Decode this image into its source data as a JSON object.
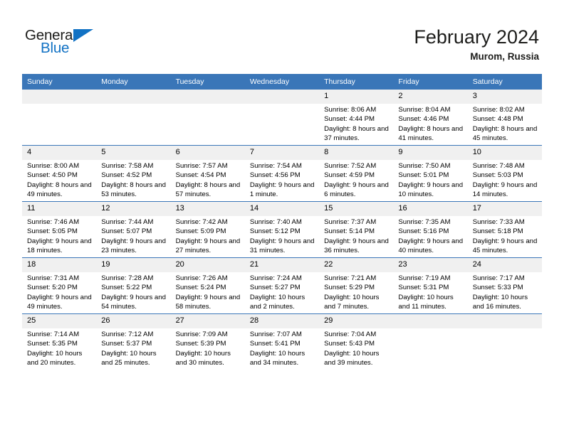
{
  "brand": {
    "name_top": "General",
    "name_bottom": "Blue",
    "accent_color": "#1272c4",
    "triangle_icon": "triangle-icon"
  },
  "header": {
    "title": "February 2024",
    "subtitle": "Murom, Russia"
  },
  "calendar": {
    "header_bg": "#3a76b8",
    "daynum_bg": "#f0f0f0",
    "weekday_names": [
      "Sunday",
      "Monday",
      "Tuesday",
      "Wednesday",
      "Thursday",
      "Friday",
      "Saturday"
    ],
    "weeks": [
      [
        {
          "day": "",
          "empty": true
        },
        {
          "day": "",
          "empty": true
        },
        {
          "day": "",
          "empty": true
        },
        {
          "day": "",
          "empty": true
        },
        {
          "day": "1",
          "sunrise": "Sunrise: 8:06 AM",
          "sunset": "Sunset: 4:44 PM",
          "daylight": "Daylight: 8 hours and 37 minutes."
        },
        {
          "day": "2",
          "sunrise": "Sunrise: 8:04 AM",
          "sunset": "Sunset: 4:46 PM",
          "daylight": "Daylight: 8 hours and 41 minutes."
        },
        {
          "day": "3",
          "sunrise": "Sunrise: 8:02 AM",
          "sunset": "Sunset: 4:48 PM",
          "daylight": "Daylight: 8 hours and 45 minutes."
        }
      ],
      [
        {
          "day": "4",
          "sunrise": "Sunrise: 8:00 AM",
          "sunset": "Sunset: 4:50 PM",
          "daylight": "Daylight: 8 hours and 49 minutes."
        },
        {
          "day": "5",
          "sunrise": "Sunrise: 7:58 AM",
          "sunset": "Sunset: 4:52 PM",
          "daylight": "Daylight: 8 hours and 53 minutes."
        },
        {
          "day": "6",
          "sunrise": "Sunrise: 7:57 AM",
          "sunset": "Sunset: 4:54 PM",
          "daylight": "Daylight: 8 hours and 57 minutes."
        },
        {
          "day": "7",
          "sunrise": "Sunrise: 7:54 AM",
          "sunset": "Sunset: 4:56 PM",
          "daylight": "Daylight: 9 hours and 1 minute."
        },
        {
          "day": "8",
          "sunrise": "Sunrise: 7:52 AM",
          "sunset": "Sunset: 4:59 PM",
          "daylight": "Daylight: 9 hours and 6 minutes."
        },
        {
          "day": "9",
          "sunrise": "Sunrise: 7:50 AM",
          "sunset": "Sunset: 5:01 PM",
          "daylight": "Daylight: 9 hours and 10 minutes."
        },
        {
          "day": "10",
          "sunrise": "Sunrise: 7:48 AM",
          "sunset": "Sunset: 5:03 PM",
          "daylight": "Daylight: 9 hours and 14 minutes."
        }
      ],
      [
        {
          "day": "11",
          "sunrise": "Sunrise: 7:46 AM",
          "sunset": "Sunset: 5:05 PM",
          "daylight": "Daylight: 9 hours and 18 minutes."
        },
        {
          "day": "12",
          "sunrise": "Sunrise: 7:44 AM",
          "sunset": "Sunset: 5:07 PM",
          "daylight": "Daylight: 9 hours and 23 minutes."
        },
        {
          "day": "13",
          "sunrise": "Sunrise: 7:42 AM",
          "sunset": "Sunset: 5:09 PM",
          "daylight": "Daylight: 9 hours and 27 minutes."
        },
        {
          "day": "14",
          "sunrise": "Sunrise: 7:40 AM",
          "sunset": "Sunset: 5:12 PM",
          "daylight": "Daylight: 9 hours and 31 minutes."
        },
        {
          "day": "15",
          "sunrise": "Sunrise: 7:37 AM",
          "sunset": "Sunset: 5:14 PM",
          "daylight": "Daylight: 9 hours and 36 minutes."
        },
        {
          "day": "16",
          "sunrise": "Sunrise: 7:35 AM",
          "sunset": "Sunset: 5:16 PM",
          "daylight": "Daylight: 9 hours and 40 minutes."
        },
        {
          "day": "17",
          "sunrise": "Sunrise: 7:33 AM",
          "sunset": "Sunset: 5:18 PM",
          "daylight": "Daylight: 9 hours and 45 minutes."
        }
      ],
      [
        {
          "day": "18",
          "sunrise": "Sunrise: 7:31 AM",
          "sunset": "Sunset: 5:20 PM",
          "daylight": "Daylight: 9 hours and 49 minutes."
        },
        {
          "day": "19",
          "sunrise": "Sunrise: 7:28 AM",
          "sunset": "Sunset: 5:22 PM",
          "daylight": "Daylight: 9 hours and 54 minutes."
        },
        {
          "day": "20",
          "sunrise": "Sunrise: 7:26 AM",
          "sunset": "Sunset: 5:24 PM",
          "daylight": "Daylight: 9 hours and 58 minutes."
        },
        {
          "day": "21",
          "sunrise": "Sunrise: 7:24 AM",
          "sunset": "Sunset: 5:27 PM",
          "daylight": "Daylight: 10 hours and 2 minutes."
        },
        {
          "day": "22",
          "sunrise": "Sunrise: 7:21 AM",
          "sunset": "Sunset: 5:29 PM",
          "daylight": "Daylight: 10 hours and 7 minutes."
        },
        {
          "day": "23",
          "sunrise": "Sunrise: 7:19 AM",
          "sunset": "Sunset: 5:31 PM",
          "daylight": "Daylight: 10 hours and 11 minutes."
        },
        {
          "day": "24",
          "sunrise": "Sunrise: 7:17 AM",
          "sunset": "Sunset: 5:33 PM",
          "daylight": "Daylight: 10 hours and 16 minutes."
        }
      ],
      [
        {
          "day": "25",
          "sunrise": "Sunrise: 7:14 AM",
          "sunset": "Sunset: 5:35 PM",
          "daylight": "Daylight: 10 hours and 20 minutes."
        },
        {
          "day": "26",
          "sunrise": "Sunrise: 7:12 AM",
          "sunset": "Sunset: 5:37 PM",
          "daylight": "Daylight: 10 hours and 25 minutes."
        },
        {
          "day": "27",
          "sunrise": "Sunrise: 7:09 AM",
          "sunset": "Sunset: 5:39 PM",
          "daylight": "Daylight: 10 hours and 30 minutes."
        },
        {
          "day": "28",
          "sunrise": "Sunrise: 7:07 AM",
          "sunset": "Sunset: 5:41 PM",
          "daylight": "Daylight: 10 hours and 34 minutes."
        },
        {
          "day": "29",
          "sunrise": "Sunrise: 7:04 AM",
          "sunset": "Sunset: 5:43 PM",
          "daylight": "Daylight: 10 hours and 39 minutes."
        },
        {
          "day": "",
          "empty": true
        },
        {
          "day": "",
          "empty": true
        }
      ]
    ]
  }
}
